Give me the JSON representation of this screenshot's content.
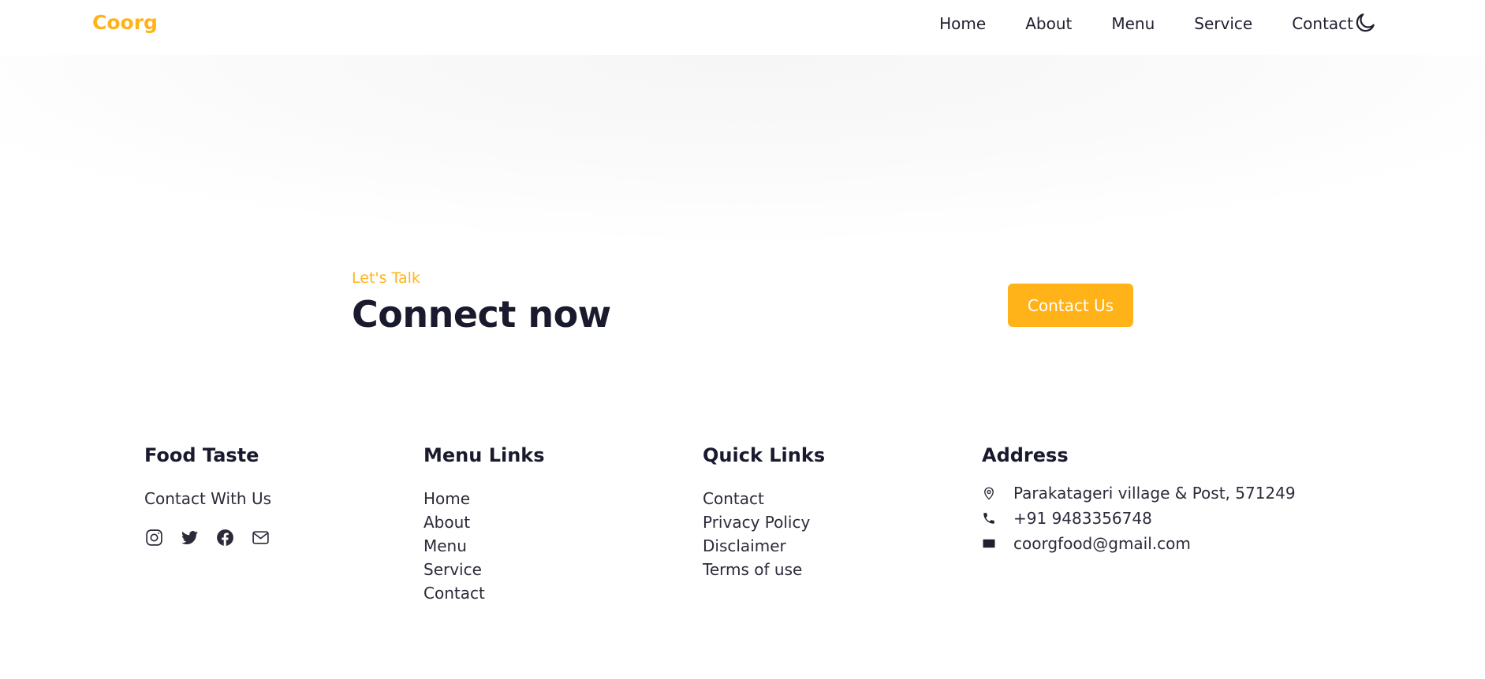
{
  "header": {
    "logo": "Coorg",
    "nav": [
      "Home",
      "About",
      "Menu",
      "Service",
      "Contact"
    ],
    "theme_icon": "moon-icon"
  },
  "cta": {
    "eyebrow": "Let's Talk",
    "title": "Connect now",
    "button": "Contact Us"
  },
  "footer": {
    "food_taste": {
      "heading": "Food Taste",
      "text": "Contact With Us",
      "socials": [
        "instagram-icon",
        "twitter-icon",
        "facebook-icon",
        "mail-icon"
      ]
    },
    "menu_links": {
      "heading": "Menu Links",
      "links": [
        "Home",
        "About",
        "Menu",
        "Service",
        "Contact"
      ]
    },
    "quick_links": {
      "heading": "Quick Links",
      "links": [
        "Contact",
        "Privacy Policy",
        "Disclaimer",
        "Terms of use"
      ]
    },
    "address": {
      "heading": "Address",
      "location": "Parakatageri village & Post, 571249",
      "phone": "+91 9483356748",
      "email": "coorgfood@gmail.com"
    }
  },
  "colors": {
    "accent": "#ffb318",
    "text": "#1a1a2e"
  }
}
